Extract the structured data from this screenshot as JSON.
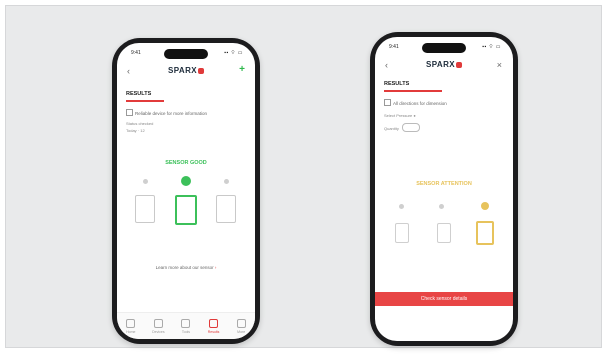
{
  "phone1": {
    "status_time": "9:41",
    "status_icons": "▪▪ ⌔ ▭",
    "back_label": "‹",
    "logo_text": "SPARX",
    "plus_label": "+",
    "results_heading": "RESULTS",
    "checkbox_label": "Reliable device for more information",
    "detail_line1": "Status checked",
    "detail_line2": "Today · 12",
    "status_title": "SENSOR GOOD",
    "link_text": "Learn more about our sensor",
    "link_arrow": "›",
    "tabs": [
      {
        "label": "Home"
      },
      {
        "label": "Devices"
      },
      {
        "label": "Tools"
      },
      {
        "label": "Results"
      },
      {
        "label": "More"
      }
    ]
  },
  "phone2": {
    "status_time": "9:41",
    "status_icons": "▪▪ ⌔ ▭",
    "back_label": "‹",
    "logo_text": "SPARX",
    "close_label": "×",
    "results_heading": "RESULTS",
    "checkbox_label": "All directions for dimension",
    "detail_line1": "Select Pressure",
    "detail_value": "●",
    "detail_line2": "Quantity",
    "status_title": "SENSOR ATTENTION",
    "button_label": "Check sensor details"
  },
  "colors": {
    "accent_red": "#e23b3b",
    "good_green": "#3cc05a",
    "attention_gold": "#e7c35c"
  }
}
